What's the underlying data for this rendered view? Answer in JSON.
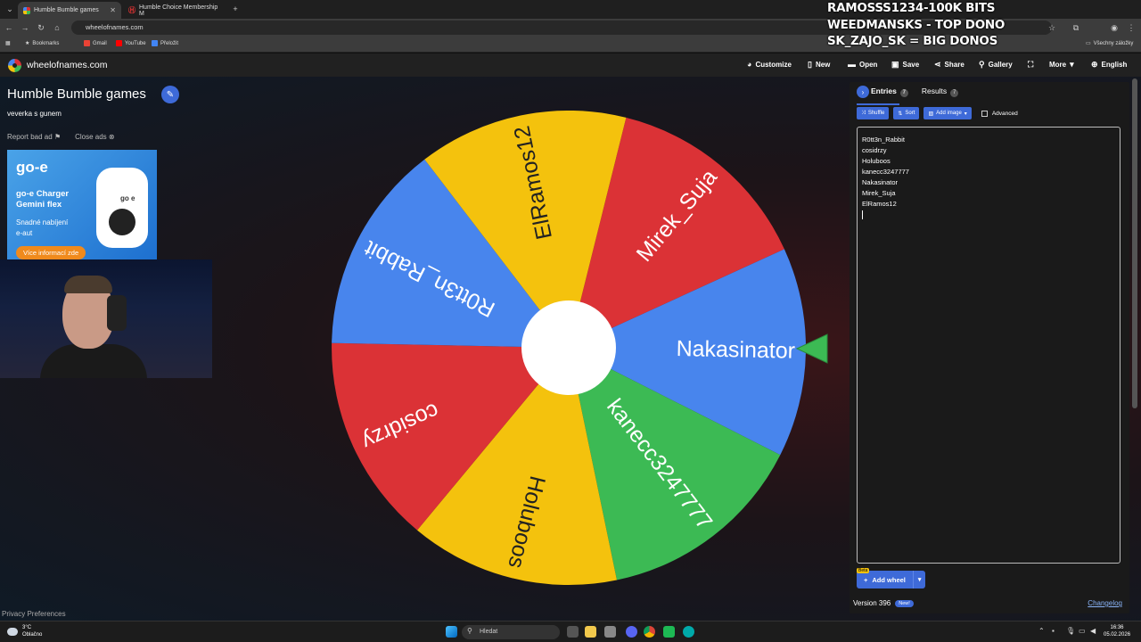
{
  "browser": {
    "tabs": [
      {
        "label": "Humble Bumble games",
        "active": true
      },
      {
        "label": "Humble Choice Membership M",
        "active": false
      }
    ],
    "url": "wheelofnames.com",
    "bookmarks": [
      "Bookmarks",
      "Gmail",
      "YouTube",
      "Přeložit"
    ],
    "other_bookmarks": "Všechny záložky"
  },
  "stream_overlay": [
    "RAMOSSS1234-100K BITS",
    "WEEDMANSKS - TOP DONO",
    "SK_ZAJO_SK = BIG DONOS"
  ],
  "app": {
    "brand": "wheelofnames.com",
    "menu": {
      "customize": "Customize",
      "new": "New",
      "open": "Open",
      "save": "Save",
      "share": "Share",
      "gallery": "Gallery",
      "more": "More",
      "language": "English"
    }
  },
  "wheel_info": {
    "title": "Humble Bumble games",
    "description": "veverka s gunem",
    "report_ad": "Report bad ad",
    "close_ads": "Close ads"
  },
  "ad": {
    "logo": "go-e",
    "headline_1": "go-e Charger",
    "headline_2": "Gemini flex",
    "sub_1": "Snadné nabíjení",
    "sub_2": "e-aut",
    "cta": "Více informací zde",
    "device_label": "go e"
  },
  "wheel": {
    "segments": [
      {
        "label": "Mirek_Suja",
        "color": "#db3236"
      },
      {
        "label": "Nakasinator",
        "color": "#4885ed"
      },
      {
        "label": "kanecc3247777",
        "color": "#3cba54"
      },
      {
        "label": "Holuboos",
        "color": "#f4c20d"
      },
      {
        "label": "cosidrzy",
        "color": "#db3236"
      },
      {
        "label": "R0tt3n_Rabbit",
        "color": "#4885ed"
      },
      {
        "label": "ElRamos12",
        "color": "#f4c20d"
      }
    ]
  },
  "panel": {
    "tab_entries": "Entries",
    "entries_count": "7",
    "tab_results": "Results",
    "results_count": "7",
    "shuffle": "Shuffle",
    "sort": "Sort",
    "add_image": "Add image",
    "advanced": "Advanced",
    "entries": [
      "R0tt3n_Rabbit",
      "cosidrzy",
      "Holuboos",
      "kanecc3247777",
      "Nakasinator",
      "Mirek_Suja",
      "ElRamos12"
    ],
    "beta": "Beta",
    "add_wheel": "Add wheel",
    "version": "Version 396",
    "new_badge": "New!",
    "changelog": "Changelog"
  },
  "privacy": "Privacy Preferences",
  "taskbar": {
    "temp": "3°C",
    "weather": "Oblačno",
    "search": "Hledat",
    "time": "16:36",
    "date": "05.02.2026"
  }
}
